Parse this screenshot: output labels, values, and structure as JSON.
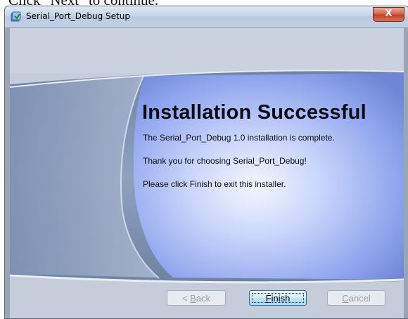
{
  "behind_text": "Click \"Next\" to continue.",
  "window": {
    "title": "Serial_Port_Debug Setup",
    "close_glyph": "X"
  },
  "content": {
    "heading": "Installation Successful",
    "line1": "The Serial_Port_Debug 1.0 installation is complete.",
    "line2": "Thank you for choosing Serial_Port_Debug!",
    "line3": "Please click Finish to exit this installer."
  },
  "buttons": {
    "back": {
      "prefix": "< ",
      "mnemonic": "B",
      "rest": "ack",
      "enabled": false
    },
    "finish": {
      "prefix": "",
      "mnemonic": "F",
      "rest": "inish",
      "enabled": true
    },
    "cancel": {
      "prefix": "",
      "mnemonic": "C",
      "rest": "ancel",
      "enabled": false
    }
  },
  "icons": {
    "app": "installer-icon",
    "close": "close-icon"
  },
  "colors": {
    "heading": "#0b0b14",
    "finish_border": "#2f6aa8",
    "close_button": "#c53e22"
  }
}
